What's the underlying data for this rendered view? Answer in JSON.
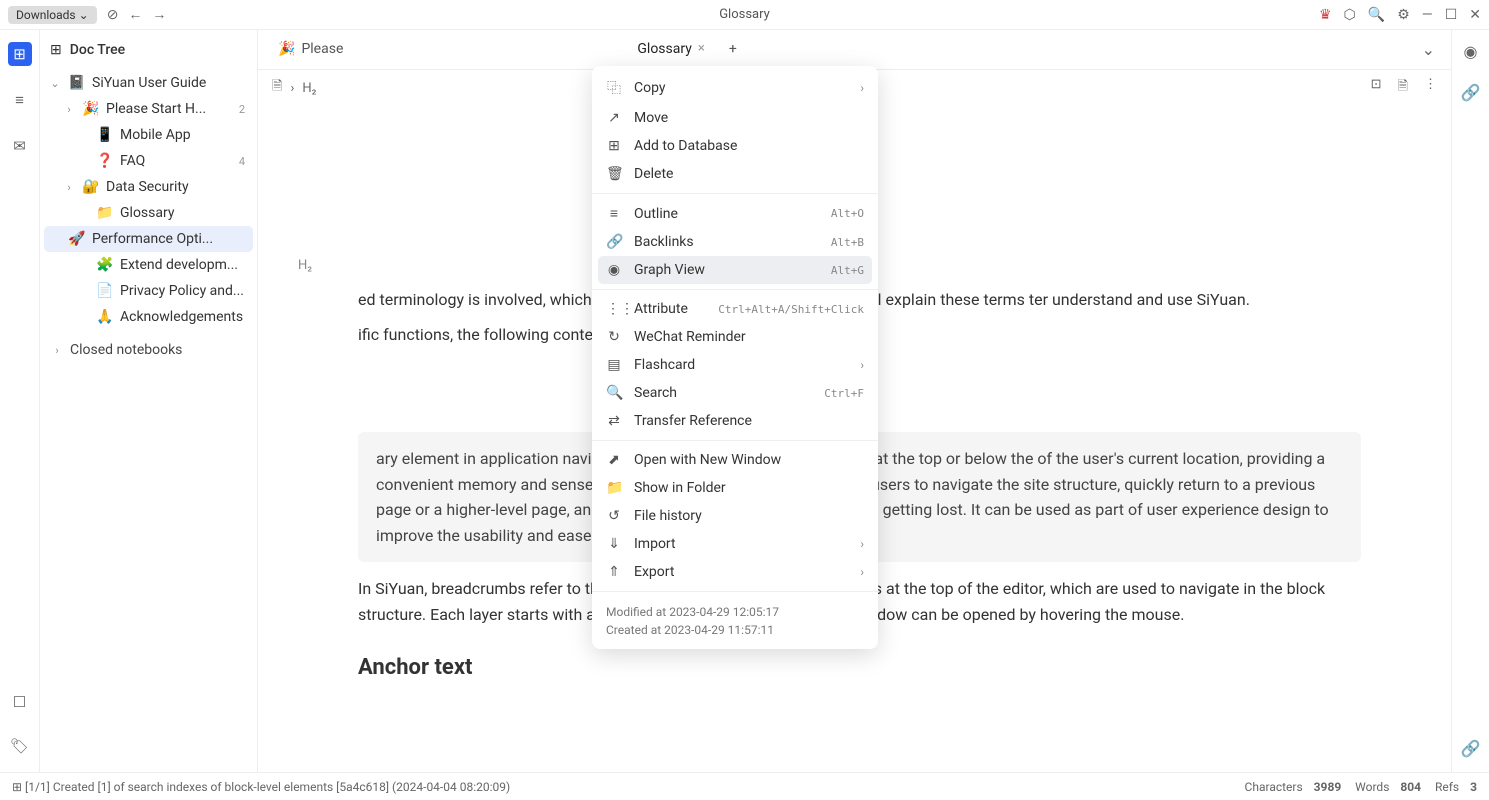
{
  "titlebar": {
    "downloads": "Downloads",
    "title": "Glossary"
  },
  "sidebar_header": "Doc Tree",
  "tree": {
    "root": "SiYuan User Guide",
    "items": [
      {
        "icon": "🎉",
        "label": "Please Start H...",
        "badge": "2",
        "arrow": true
      },
      {
        "icon": "📱",
        "label": "Mobile App"
      },
      {
        "icon": "❓",
        "label": "FAQ",
        "badge": "4"
      },
      {
        "icon": "🔐",
        "label": "Data Security",
        "arrow": true
      },
      {
        "icon": "📁",
        "label": "Glossary"
      },
      {
        "icon": "🚀",
        "label": "Performance Opti...",
        "selected": true
      },
      {
        "icon": "🧩",
        "label": "Extend developm..."
      },
      {
        "icon": "📄",
        "label": "Privacy Policy and..."
      },
      {
        "icon": "🙏",
        "label": "Acknowledgements"
      }
    ],
    "closed": "Closed notebooks"
  },
  "tabs": [
    {
      "icon": "🎉",
      "label": "Please"
    },
    {
      "icon": "",
      "label": "Glossary",
      "close": true,
      "active": true
    }
  ],
  "breadcrumb": {
    "h2": "H₂"
  },
  "context_menu": {
    "items": [
      {
        "icon": "⿻",
        "label": "Copy",
        "chevron": true
      },
      {
        "icon": "↗",
        "label": "Move"
      },
      {
        "icon": "⊞",
        "label": "Add to Database"
      },
      {
        "icon": "🗑",
        "label": "Delete"
      },
      {
        "sep": true
      },
      {
        "icon": "≡",
        "label": "Outline",
        "shortcut": "Alt+O"
      },
      {
        "icon": "🔗",
        "label": "Backlinks",
        "shortcut": "Alt+B"
      },
      {
        "icon": "◉",
        "label": "Graph View",
        "shortcut": "Alt+G",
        "hover": true
      },
      {
        "sep": true
      },
      {
        "icon": "⋮⋮",
        "label": "Attribute",
        "shortcut": "Ctrl+Alt+A/Shift+Click"
      },
      {
        "icon": "↻",
        "label": "WeChat Reminder"
      },
      {
        "icon": "▤",
        "label": "Flashcard",
        "chevron": true
      },
      {
        "icon": "🔍",
        "label": "Search",
        "shortcut": "Ctrl+F"
      },
      {
        "icon": "⇄",
        "label": "Transfer Reference"
      },
      {
        "sep": true
      },
      {
        "icon": "⬈",
        "label": "Open with New Window"
      },
      {
        "icon": "📁",
        "label": "Show in Folder"
      },
      {
        "icon": "↺",
        "label": "File history"
      },
      {
        "icon": "⇓",
        "label": "Import",
        "chevron": true
      },
      {
        "icon": "⇑",
        "label": "Export",
        "chevron": true
      }
    ],
    "modified": "Modified at 2023-04-29 12:05:17",
    "created": "Created at 2023-04-29 11:57:11"
  },
  "doc": {
    "h2_marker": "H₂",
    "p1": "ed terminology is involved, which can be confusing. In this chapter, we will explain these terms ter understand and use SiYuan.",
    "p2": "ific functions, the following content is mainly introduced on the desktop.",
    "quote": "ary element in application navigation, usually in a horizontal sequence at the top or below the of the user's current location, providing a convenient memory and sense of direction during the ake it easier for users to navigate the site structure, quickly return to a previous page or a higher-level page, and reduce the chance of invalid clicks and getting lost. It can be used as part of user experience design to improve the usability and ease of use of the application.",
    "p3": "In SiYuan, breadcrumbs refer to the block paths connected by right arrows at the top of the editor, which are used to navigate in the block structure. Each layer starts with a block icon, and the preview floating window can be opened by hovering the mouse.",
    "h2": "Anchor text"
  },
  "status": {
    "left": "[1/1] Created [1] of search indexes of block-level elements [5a4c618] (2024-04-04 08:20:09)",
    "chars_label": "Characters",
    "chars": "3989",
    "words_label": "Words",
    "words": "804",
    "refs_label": "Refs",
    "refs": "3"
  }
}
